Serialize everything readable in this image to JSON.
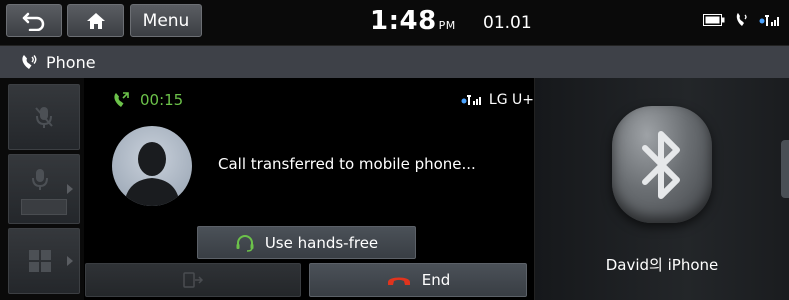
{
  "topbar": {
    "menu_label": "Menu",
    "time": "1:48",
    "ampm": "PM",
    "date": "01.01"
  },
  "title": {
    "text": "Phone"
  },
  "call": {
    "duration": "00:15",
    "carrier": "LG U+",
    "status": "Call transferred to mobile phone...",
    "handsfree_label": "Use hands-free",
    "end_label": "End"
  },
  "bluetooth": {
    "device_name": "David의 iPhone"
  },
  "colors": {
    "accent_green": "#6cc24a",
    "end_red": "#e0341e",
    "title_bar": "#3e4148"
  },
  "icons": {
    "back": "back-arrow-icon",
    "home": "home-icon",
    "battery": "battery-icon",
    "phone_status": "phone-status-icon",
    "signal": "signal-icon",
    "mute": "mic-mute-icon",
    "voice": "voice-volume-icon",
    "keypad": "keypad-icon",
    "call": "call-icon",
    "handsfree": "headset-icon",
    "end": "end-call-icon",
    "bluetooth": "bluetooth-icon",
    "avatar": "person-silhouette-icon"
  }
}
